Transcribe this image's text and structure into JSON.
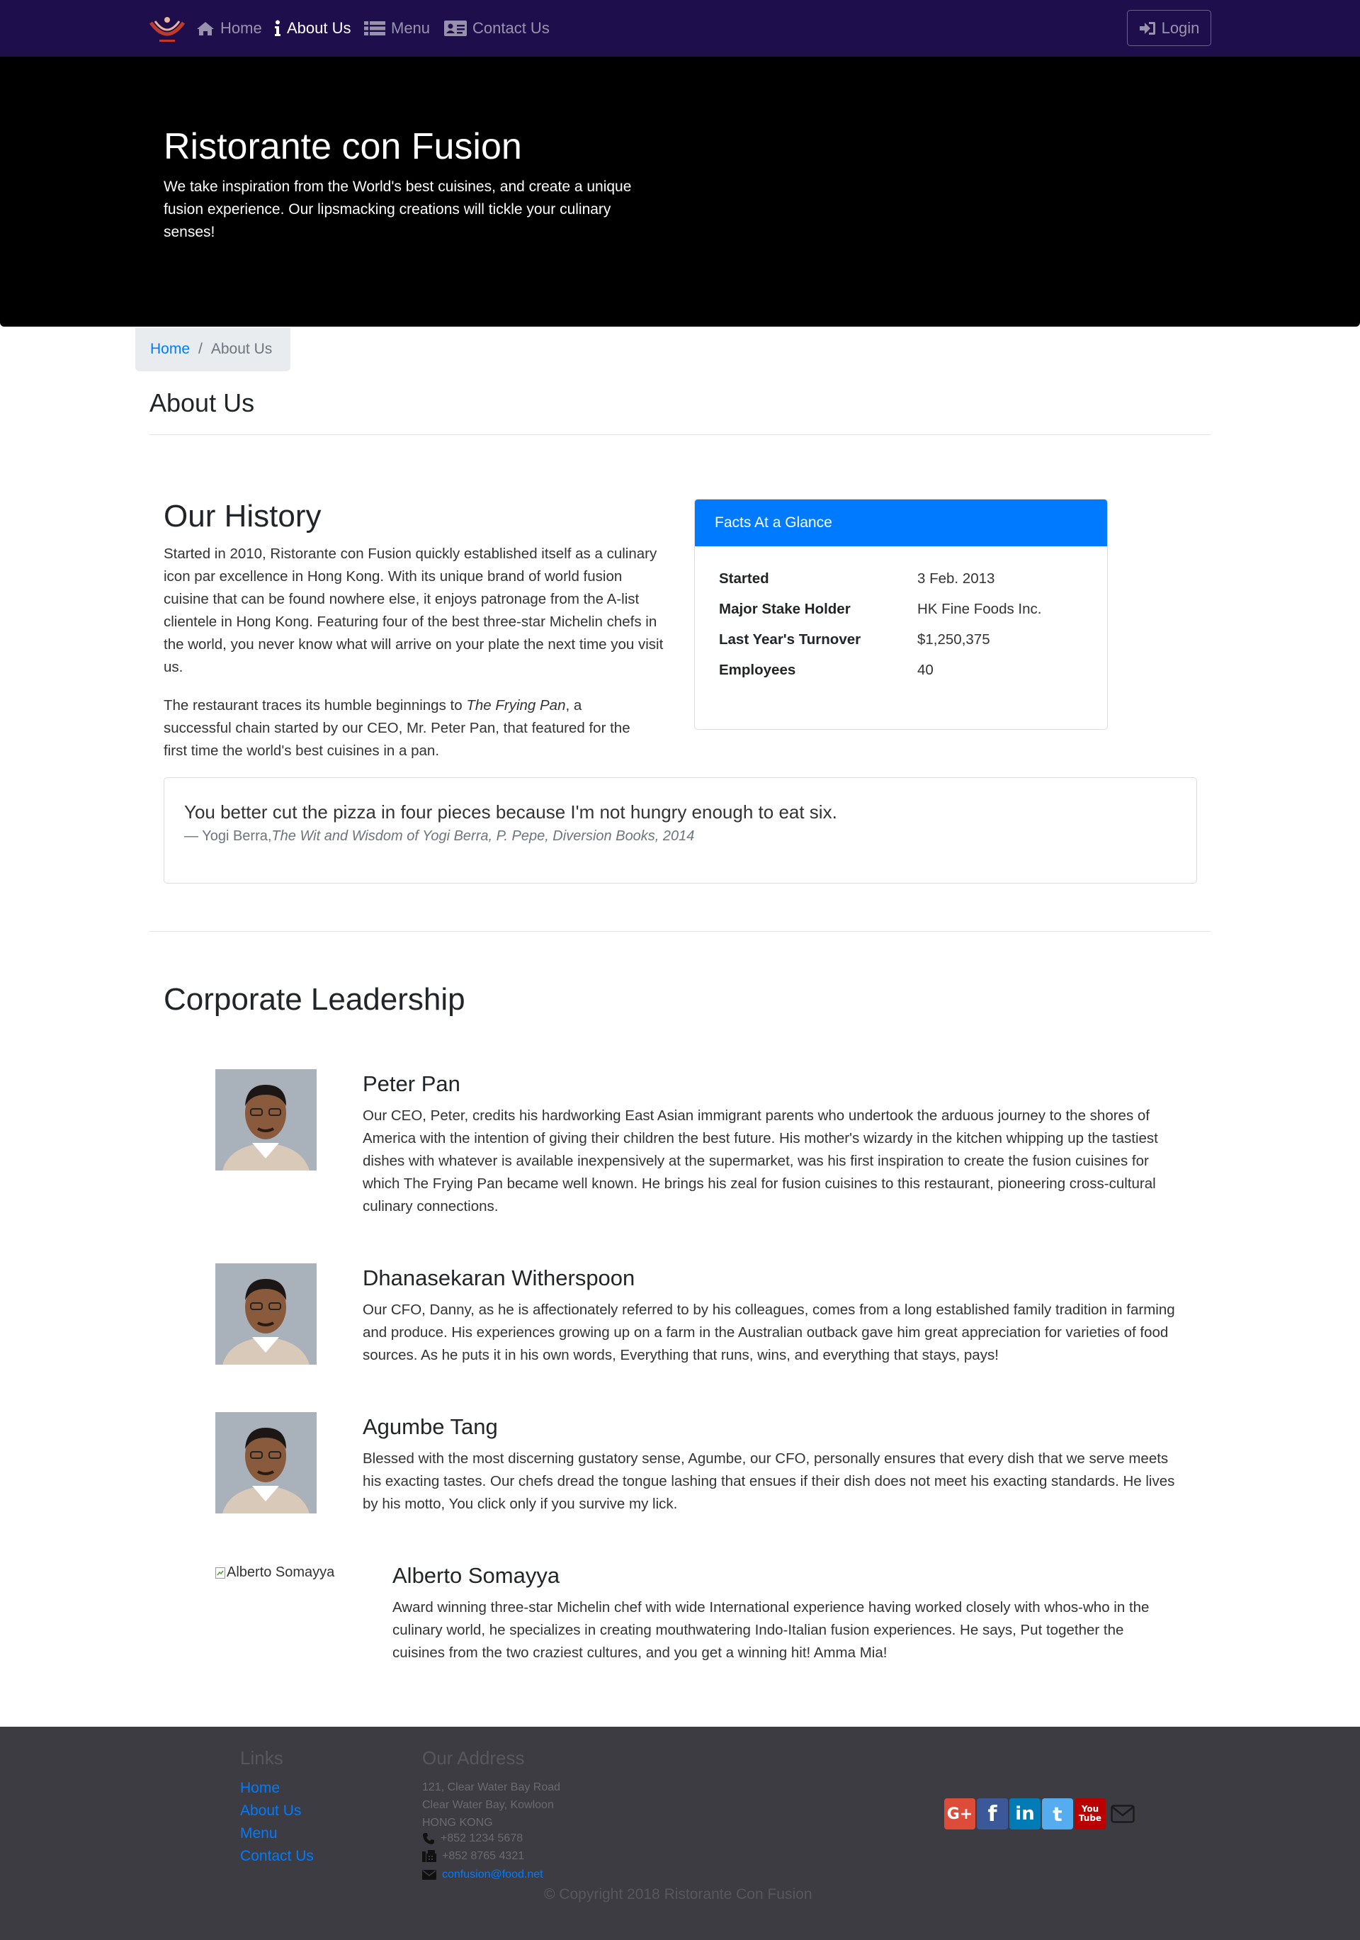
{
  "nav": {
    "items": [
      {
        "label": "Home",
        "icon": "home-icon"
      },
      {
        "label": "About Us",
        "icon": "info-icon"
      },
      {
        "label": "Menu",
        "icon": "list-icon"
      },
      {
        "label": "Contact Us",
        "icon": "address-card-icon"
      }
    ],
    "login_label": "Login"
  },
  "jumbotron": {
    "title": "Ristorante con Fusion",
    "text": "We take inspiration from the World's best cuisines, and create a unique fusion experience. Our lipsmacking creations will tickle your culinary senses!"
  },
  "breadcrumb": {
    "home": "Home",
    "current": "About Us"
  },
  "page_title": "About Us",
  "history": {
    "title": "Our History",
    "para1": "Started in 2010, Ristorante con Fusion quickly established itself as a culinary icon par excellence in Hong Kong. With its unique brand of world fusion cuisine that can be found nowhere else, it enjoys patronage from the A-list clientele in Hong Kong. Featuring four of the best three-star Michelin chefs in the world, you never know what will arrive on your plate the next time you visit us.",
    "para2_a": "The restaurant traces its humble beginnings to ",
    "para2_em": "The Frying Pan",
    "para2_b": ", a successful chain started by our CEO, Mr. Peter Pan, that featured for the first time the world's best cuisines in a pan."
  },
  "facts": {
    "header": "Facts At a Glance",
    "rows": [
      {
        "key": "Started",
        "value": "3 Feb. 2013"
      },
      {
        "key": "Major Stake Holder",
        "value": "HK Fine Foods Inc."
      },
      {
        "key": "Last Year's Turnover",
        "value": "$1,250,375"
      },
      {
        "key": "Employees",
        "value": "40"
      }
    ]
  },
  "quote": {
    "text": "You better cut the pizza in four pieces because I'm not hungry enough to eat six.",
    "author": "— Yogi Berra,",
    "source": "The Wit and Wisdom of Yogi Berra, P. Pepe, Diversion Books, 2014"
  },
  "leadership": {
    "title": "Corporate Leadership",
    "leaders": [
      {
        "name": "Peter Pan",
        "description": "Our CEO, Peter, credits his hardworking East Asian immigrant parents who undertook the arduous journey to the shores of America with the intention of giving their children the best future. His mother's wizardy in the kitchen whipping up the tastiest dishes with whatever is available inexpensively at the supermarket, was his first inspiration to create the fusion cuisines for which The Frying Pan became well known. He brings his zeal for fusion cuisines to this restaurant, pioneering cross-cultural culinary connections."
      },
      {
        "name": "Dhanasekaran Witherspoon",
        "description": "Our CFO, Danny, as he is affectionately referred to by his colleagues, comes from a long established family tradition in farming and produce. His experiences growing up on a farm in the Australian outback gave him great appreciation for varieties of food sources. As he puts it in his own words, Everything that runs, wins, and everything that stays, pays!"
      },
      {
        "name": "Agumbe Tang",
        "description": "Blessed with the most discerning gustatory sense, Agumbe, our CFO, personally ensures that every dish that we serve meets his exacting tastes. Our chefs dread the tongue lashing that ensues if their dish does not meet his exacting standards. He lives by his motto, You click only if you survive my lick."
      },
      {
        "name": "Alberto Somayya",
        "image_alt": "Alberto Somayya",
        "description": "Award winning three-star Michelin chef with wide International experience having worked closely with whos-who in the culinary world, he specializes in creating mouthwatering Indo-Italian fusion experiences. He says, Put together the cuisines from the two craziest cultures, and you get a winning hit! Amma Mia!"
      }
    ]
  },
  "footer": {
    "links_title": "Links",
    "links": [
      "Home",
      "About Us",
      "Menu",
      "Contact Us"
    ],
    "address_title": "Our Address",
    "address": [
      "121, Clear Water Bay Road",
      "Clear Water Bay, Kowloon",
      "HONG KONG"
    ],
    "phone": "+852 1234 5678",
    "fax": "+852 8765 4321",
    "email": "confusion@food.net",
    "social": [
      {
        "name": "google-plus-icon",
        "glyph": "G+",
        "color": "#dd4b39"
      },
      {
        "name": "facebook-icon",
        "glyph": "f",
        "color": "#3b5998"
      },
      {
        "name": "linkedin-icon",
        "glyph": "in",
        "color": "#007bb5"
      },
      {
        "name": "twitter-icon",
        "glyph": "t",
        "color": "#55acee"
      },
      {
        "name": "youtube-icon",
        "glyph": "You Tube",
        "color": "#bb0000"
      }
    ],
    "copyright": "© Copyright 2018 Ristorante Con Fusion"
  },
  "colors": {
    "navbar": "#1e0e4b",
    "jumbotron": "#000000",
    "primary": "#007bff",
    "footer": "#3d3c42"
  }
}
